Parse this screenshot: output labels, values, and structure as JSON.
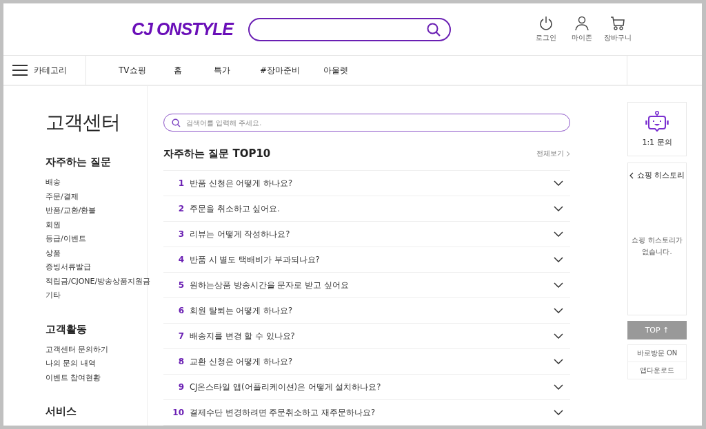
{
  "header": {
    "logo": "CJ ONSTYLE",
    "user_menu": [
      {
        "label": "로그인",
        "kind": "power"
      },
      {
        "label": "마이존",
        "kind": "person"
      },
      {
        "label": "장바구니",
        "kind": "cart"
      }
    ]
  },
  "nav": {
    "category_button": "카테고리",
    "items": [
      "TV쇼핑",
      "홈",
      "특가",
      "#장마준비",
      "아울렛"
    ]
  },
  "sidebar": {
    "title": "고객센터",
    "sections": [
      {
        "heading": "자주하는 질문",
        "links": [
          "배송",
          "주문/결제",
          "반품/교환/환불",
          "회원",
          "등급/이벤트",
          "상품",
          "증빙서류발급",
          "적립금/CJONE/방송상품지원금",
          "기타"
        ]
      },
      {
        "heading": "고객활동",
        "links": [
          "고객센터 문의하기",
          "나의 문의 내역",
          "이벤트 참여현황"
        ]
      },
      {
        "heading": "서비스"
      }
    ]
  },
  "search": {
    "placeholder": "검색어를 입력해 주세요."
  },
  "faq": {
    "title": "자주하는 질문 TOP10",
    "view_all": "전체보기",
    "items": [
      {
        "number": "1",
        "question": "반품 신청은 어떻게 하나요?",
        "expanded": false
      },
      {
        "number": "2",
        "question": "주문을 취소하고 싶어요.",
        "expanded": false
      },
      {
        "number": "3",
        "question": "리뷰는 어떻게 작성하나요?",
        "expanded": false
      },
      {
        "number": "4",
        "question": "반품 시 별도 택배비가 부과되나요?",
        "expanded": false
      },
      {
        "number": "5",
        "question": "원하는상품 방송시간을 문자로 받고 싶어요",
        "expanded": false
      },
      {
        "number": "6",
        "question": "회원 탈퇴는 어떻게 하나요?",
        "expanded": false
      },
      {
        "number": "7",
        "question": "배송지를 변경 할 수 있나요?",
        "expanded": false
      },
      {
        "number": "8",
        "question": "교환 신청은 어떻게 하나요?",
        "expanded": false
      },
      {
        "number": "9",
        "question": "CJ온스타일 앱(어플리케이션)은 어떻게 설치하나요?",
        "expanded": false
      },
      {
        "number": "10",
        "question": "결제수단 변경하려면 주문취소하고 재주문하나요?",
        "expanded": false
      }
    ]
  },
  "right_rail": {
    "inquiry": "1:1 문의",
    "history_title": "쇼핑 히스토리",
    "history_empty": "쇼핑 히스토리가 없습니다.",
    "top_button": "TOP ↑",
    "links": [
      "바로방문 ON",
      "앱다운로드"
    ]
  }
}
